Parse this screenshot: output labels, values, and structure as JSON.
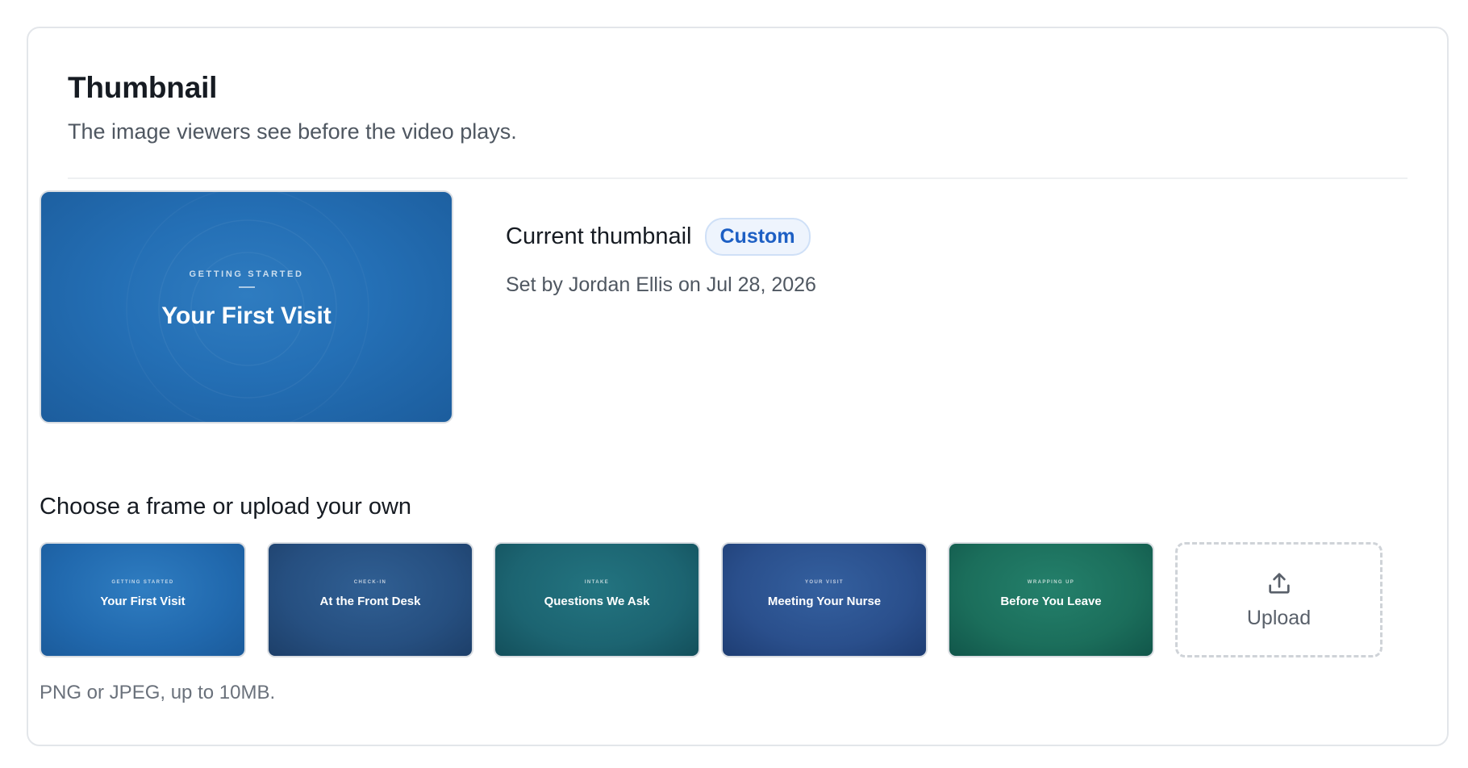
{
  "card": {
    "title": "Thumbnail",
    "subtitle": "The image viewers see before the video plays."
  },
  "current": {
    "eyebrow": "GETTING STARTED",
    "title": "Your First Visit",
    "label": "Current thumbnail",
    "badge": "Custom",
    "meta": "Set by Jordan Ellis on Jul 28, 2026"
  },
  "frames_section": {
    "title": "Choose a frame or upload your own",
    "frames": [
      {
        "eyebrow": "GETTING STARTED",
        "title": "Your First Visit"
      },
      {
        "eyebrow": "CHECK-IN",
        "title": "At the Front Desk"
      },
      {
        "eyebrow": "INTAKE",
        "title": "Questions We Ask"
      },
      {
        "eyebrow": "YOUR VISIT",
        "title": "Meeting Your Nurse"
      },
      {
        "eyebrow": "WRAPPING UP",
        "title": "Before You Leave"
      }
    ],
    "upload_label": "Upload",
    "upload_icon": "upload-icon",
    "help": "PNG or JPEG, up to 10MB."
  },
  "colors": {
    "badge_text": "#1d5fc4",
    "badge_bg": "#eef4fd"
  }
}
